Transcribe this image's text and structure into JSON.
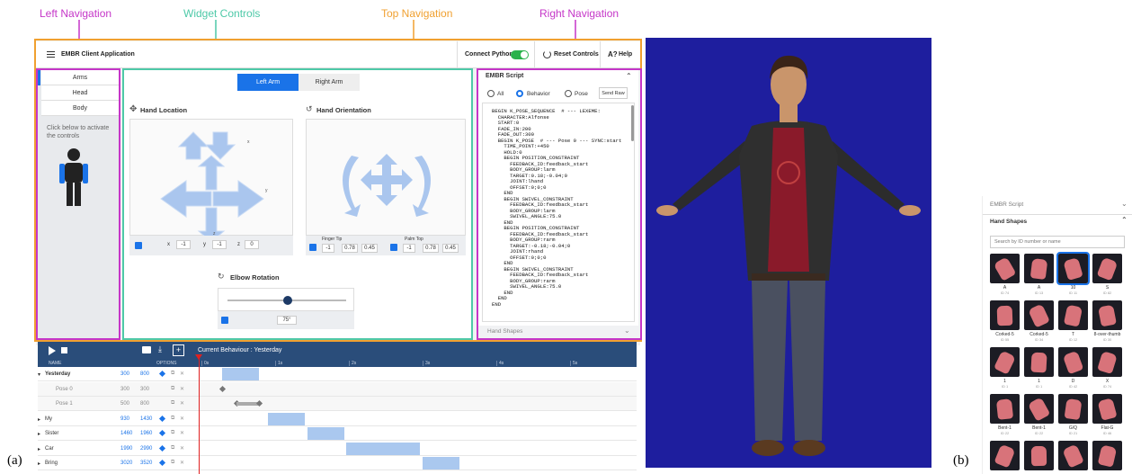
{
  "annotations": {
    "left_navigation": "Left Navigation",
    "widget_controls": "Widget Controls",
    "top_navigation": "Top Navigation",
    "right_navigation": "Right Navigation",
    "label_a": "(a)",
    "label_b": "(b)"
  },
  "colors": {
    "left": "#c536c8",
    "widget": "#4ec9a8",
    "top": "#f0a030",
    "right": "#c536c8",
    "accent": "#1a73e8"
  },
  "topbar": {
    "title": "EMBR Client Application",
    "connect_python": "Connect Python",
    "connect_python_on": true,
    "reset_controls": "Reset Controls",
    "help": "Help"
  },
  "left_nav": {
    "items": [
      "Arms",
      "Head",
      "Body"
    ],
    "selected": "Arms",
    "hint": "Click below to activate the controls"
  },
  "widgets": {
    "tabs": [
      "Left Arm",
      "Right Arm"
    ],
    "active_tab": "Left Arm",
    "hand_location": {
      "title": "Hand Location",
      "x_label": "x",
      "x_value": "-1",
      "y_label": "y",
      "y_value": "-1",
      "z_label": "z",
      "z_value": "0",
      "axis_x": "x",
      "axis_y": "y",
      "axis_z": "z"
    },
    "hand_orientation": {
      "title": "Hand Orientation",
      "finger_tip": "Finger Tip",
      "finger_tip_values": [
        "-1",
        "0.78",
        "0.45"
      ],
      "palm_top": "Palm Top",
      "palm_top_values": [
        "-1",
        "0.78",
        "0.45"
      ]
    },
    "elbow_rotation": {
      "title": "Elbow Rotation",
      "value": "75°",
      "slider_fraction": 0.5
    }
  },
  "right_nav": {
    "script_title": "EMBR Script",
    "radios": [
      "All",
      "Behavior",
      "Pose"
    ],
    "selected_radio": "Behavior",
    "send_raw": "Send Raw",
    "script_lines": [
      "BEGIN K_POSE_SEQUENCE  # --- LEXEME:",
      "  CHARACTER:Alfonse",
      "  START:0",
      "  FADE_IN:200",
      "  FADE_OUT:300",
      "  BEGIN K_POSE  # --- Pose 0 --- SYNC:start",
      "    TIME_POINT:+450",
      "    HOLD:0",
      "    BEGIN POSITION_CONSTRAINT",
      "      FEEDBACK_ID:feedback_start",
      "      BODY_GROUP:larm",
      "      TARGET:0.18;-0.04;0",
      "      JOINT:lhand",
      "      OFFSET:0;0;0",
      "    END",
      "    BEGIN SWIVEL_CONSTRAINT",
      "      FEEDBACK_ID:feedback_start",
      "      BODY_GROUP:larm",
      "      SWIVEL_ANGLE:75.0",
      "    END",
      "    BEGIN POSITION_CONSTRAINT",
      "      FEEDBACK_ID:feedback_start",
      "      BODY_GROUP:rarm",
      "      TARGET:-0.18;-0.04;0",
      "      JOINT:rhand",
      "      OFFSET:0;0;0",
      "    END",
      "    BEGIN SWIVEL_CONSTRAINT",
      "      FEEDBACK_ID:feedback_start",
      "      BODY_GROUP:rarm",
      "      SWIVEL_ANGLE:75.0",
      "    END",
      "  END",
      "END"
    ],
    "hand_shapes": "Hand Shapes"
  },
  "timeline": {
    "current_behaviour": "Current Behaviour : Yesterday",
    "col_name": "NAME",
    "col_options": "OPTIONS",
    "ticks": [
      "0s",
      "1s",
      "2s",
      "3s",
      "4s",
      "5s"
    ],
    "rows": [
      {
        "name": "Yesterday",
        "start": "300",
        "end": "800",
        "level": 0,
        "expanded": true
      },
      {
        "name": "Pose 0",
        "start": "300",
        "end": "300",
        "level": 1
      },
      {
        "name": "Pose 1",
        "start": "500",
        "end": "800",
        "level": 1
      },
      {
        "name": "My",
        "start": "930",
        "end": "1430",
        "level": 0
      },
      {
        "name": "Sister",
        "start": "1460",
        "end": "1960",
        "level": 0
      },
      {
        "name": "Car",
        "start": "1990",
        "end": "2990",
        "level": 0
      },
      {
        "name": "Bring",
        "start": "3020",
        "end": "3520",
        "level": 0
      }
    ]
  },
  "hand_shapes_panel": {
    "script_title": "EMBR Script",
    "title": "Hand Shapes",
    "search_placeholder": "Search by ID number or name",
    "thumbnails": [
      {
        "label": "A",
        "id": "ID 74"
      },
      {
        "label": "A",
        "id": "ID 13"
      },
      {
        "label": "10",
        "id": "ID 11"
      },
      {
        "label": "S",
        "id": "ID 82"
      },
      {
        "label": "Corked-5",
        "id": "ID 55"
      },
      {
        "label": "Corked-5",
        "id": "ID 34"
      },
      {
        "label": "T",
        "id": "ID 12"
      },
      {
        "label": "8-over-thumb",
        "id": "ID 30"
      },
      {
        "label": "1",
        "id": "ID 1"
      },
      {
        "label": "1",
        "id": "ID 1"
      },
      {
        "label": "D",
        "id": "ID 42"
      },
      {
        "label": "X",
        "id": "ID 74"
      },
      {
        "label": "Bent-1",
        "id": "ID 22"
      },
      {
        "label": "Bent-1",
        "id": "ID 22"
      },
      {
        "label": "G/Q",
        "id": "ID 21"
      },
      {
        "label": "Flat-G",
        "id": "ID 46"
      },
      {
        "label": "",
        "id": ""
      },
      {
        "label": "",
        "id": ""
      },
      {
        "label": "",
        "id": ""
      },
      {
        "label": "",
        "id": ""
      }
    ],
    "selected_index": 2
  }
}
